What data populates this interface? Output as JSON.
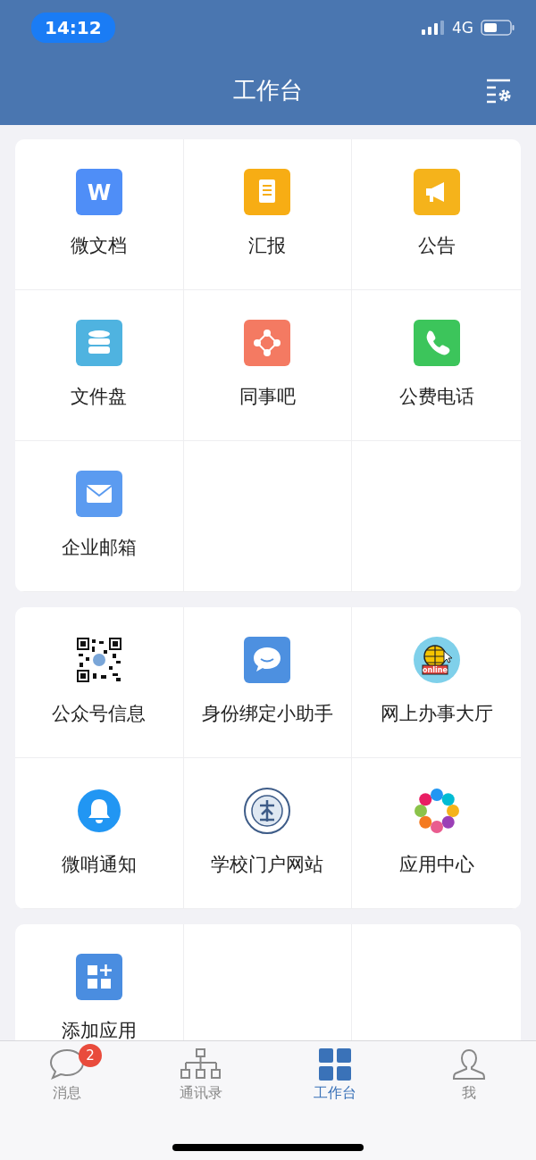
{
  "status_bar": {
    "time": "14:12",
    "network": "4G"
  },
  "header": {
    "title": "工作台"
  },
  "sections": [
    {
      "items": [
        {
          "label": "微文档",
          "icon_text": "W"
        },
        {
          "label": "汇报"
        },
        {
          "label": "公告"
        },
        {
          "label": "文件盘"
        },
        {
          "label": "同事吧"
        },
        {
          "label": "公费电话"
        },
        {
          "label": "企业邮箱"
        }
      ]
    },
    {
      "items": [
        {
          "label": "公众号信息"
        },
        {
          "label": "身份绑定小助手"
        },
        {
          "label": "网上办事大厅",
          "icon_text": "online"
        },
        {
          "label": "微哨通知"
        },
        {
          "label": "学校门户网站"
        },
        {
          "label": "应用中心"
        }
      ]
    },
    {
      "items": [
        {
          "label": "添加应用"
        }
      ]
    }
  ],
  "tab_bar": [
    {
      "label": "消息",
      "selected": false,
      "badge": "2"
    },
    {
      "label": "通讯录",
      "selected": false
    },
    {
      "label": "工作台",
      "selected": true
    },
    {
      "label": "我",
      "selected": false
    }
  ]
}
